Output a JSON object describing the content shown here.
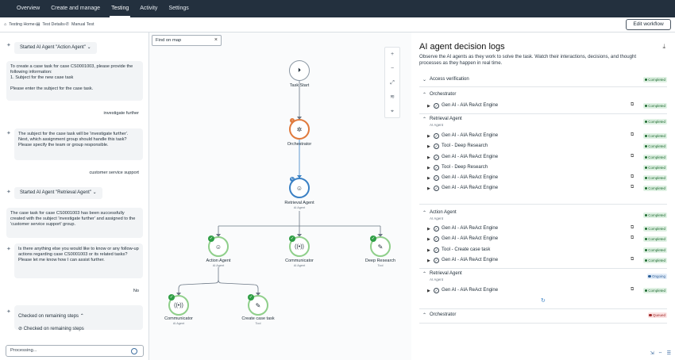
{
  "nav": {
    "tabs": [
      "Overview",
      "Create and manage",
      "Testing",
      "Activity",
      "Settings"
    ]
  },
  "breadcrumb": [
    "Testing Home",
    "Test Details",
    "Manual Test"
  ],
  "header": {
    "edit_button": "Edit workflow"
  },
  "chat": {
    "agent1": "Started AI Agent \"Action Agent\"",
    "msg1": "To create a case task for case CS0001003, please provide the following information:\n1. Subject for the new case task\n\nPlease enter the subject for the case task.",
    "user1": "investigate further",
    "msg2": "The subject for the case task will be 'investigate further'. Next, which assignment group should handle this task? Please specify the team or group responsible.",
    "user2": "customer service support",
    "agent2": "Started AI Agent \"Retrieval Agent\"",
    "msg3": "The case task for case CS0001003 has been successfully created with the subject 'investigate further' and assigned to the 'customer service support' group.",
    "msg4": "Is there anything else you would like to know or any follow-up actions regarding case CS0001003 or its related tasks? Please let me know how I can assist further.",
    "user3": "No",
    "steps_title": "Checked on remaining steps",
    "steps_item": "Checked on remaining steps",
    "input_placeholder": "Processing..."
  },
  "canvas": {
    "find_placeholder": "Find on map",
    "nodes": {
      "task_start": "Task Start",
      "orchestrator": "Orchestrator",
      "retrieval": "Retrieval Agent",
      "retrieval_sub": "AI Agent",
      "action": "Action Agent",
      "action_sub": "AI Agent",
      "communicator1": "Communicator",
      "communicator1_sub": "AI Agent",
      "deep_research": "Deep Research",
      "deep_research_sub": "Tool",
      "communicator2": "Communicator",
      "communicator2_sub": "AI Agent",
      "create_case": "Create case task",
      "create_case_sub": "Tool"
    }
  },
  "logs": {
    "title": "AI agent decision logs",
    "description": "Observe the AI agents as they work to solve the task. Watch their interactions, decisions, and thought processes as they happen in real time.",
    "access": "Access verification",
    "orchestrator": "Orchestrator",
    "gen1": "Gen AI - AIA ReAct Engine",
    "retrieval": "Retrieval Agent",
    "retrieval_sub": "AI Agent",
    "r_items": [
      "Gen AI - AIA ReAct Engine",
      "Tool - Deep Research",
      "Gen AI - AIA ReAct Engine",
      "Tool - Deep Research",
      "Gen AI - AIA ReAct Engine",
      "Gen AI - AIA ReAct Engine"
    ],
    "action": "Action Agent",
    "action_sub": "AI Agent",
    "a_items": [
      "Gen AI - AIA ReAct Engine",
      "Gen AI - AIA ReAct Engine",
      "Tool - Create case task",
      "Gen AI - AIA ReAct Engine"
    ],
    "retrieval2": "Retrieval Agent",
    "retrieval2_sub": "AI Agent",
    "r2_item": "Gen AI - AIA ReAct Engine",
    "orchestrator2": "Orchestrator",
    "status_completed": "Completed",
    "status_ongoing": "Ongoing",
    "status_queued": "Queued"
  }
}
